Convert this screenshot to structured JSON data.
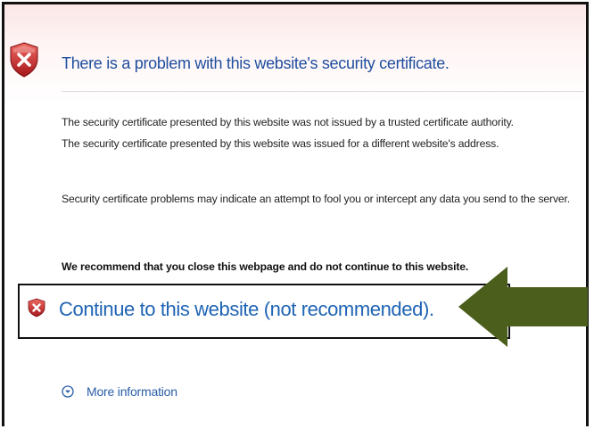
{
  "header": {
    "title": "There is a problem with this website's security certificate."
  },
  "body": {
    "line1": "The security certificate presented by this website was not issued by a trusted certificate authority.",
    "line2": "The security certificate presented by this website was issued for a different website's address.",
    "line3": "Security certificate problems may indicate an attempt to fool you or intercept any data you send to the server.",
    "recommendation": "We recommend that you close this webpage and do not continue to this website."
  },
  "actions": {
    "continue_label": "Continue to this website (not recommended).",
    "more_info_label": "More information"
  },
  "icons": {
    "header": "shield-error-icon",
    "continue": "shield-error-icon",
    "more_info": "chevron-circle-down-icon",
    "annotation": "arrow-left-icon"
  },
  "colors": {
    "title": "#1f4e9e",
    "link": "#1f64b4",
    "shield": "#c8282a",
    "arrow": "#4b5e1c"
  }
}
